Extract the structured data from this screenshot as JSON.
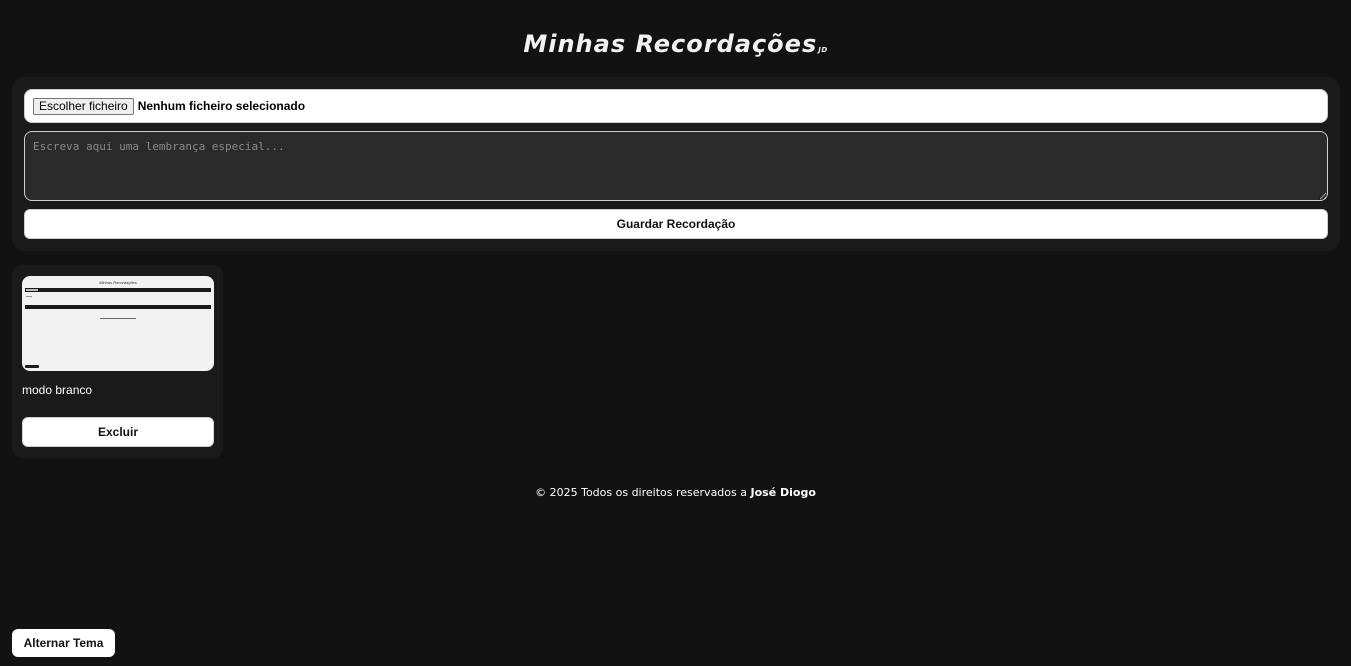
{
  "header": {
    "title": "Minhas Recordações",
    "subtitle": "JD"
  },
  "form": {
    "file_button_label": "Escolher ficheiro",
    "file_status": "Nenhum ficheiro selecionado",
    "memory_placeholder": "Escreva aqui uma lembrança especial...",
    "memory_value": "",
    "save_label": "Guardar Recordação"
  },
  "memories": [
    {
      "thumbnail": "screenshot-light-mode",
      "text": "modo branco",
      "delete_label": "Excluir"
    }
  ],
  "footer": {
    "text": "© 2025 Todos os direitos reservados a",
    "author": "José Diogo"
  },
  "theme_toggle_label": "Alternar Tema",
  "colors": {
    "background": "#121212",
    "panel": "#1a1a1a",
    "input": "#2a2a2a",
    "button": "#ffffff"
  }
}
